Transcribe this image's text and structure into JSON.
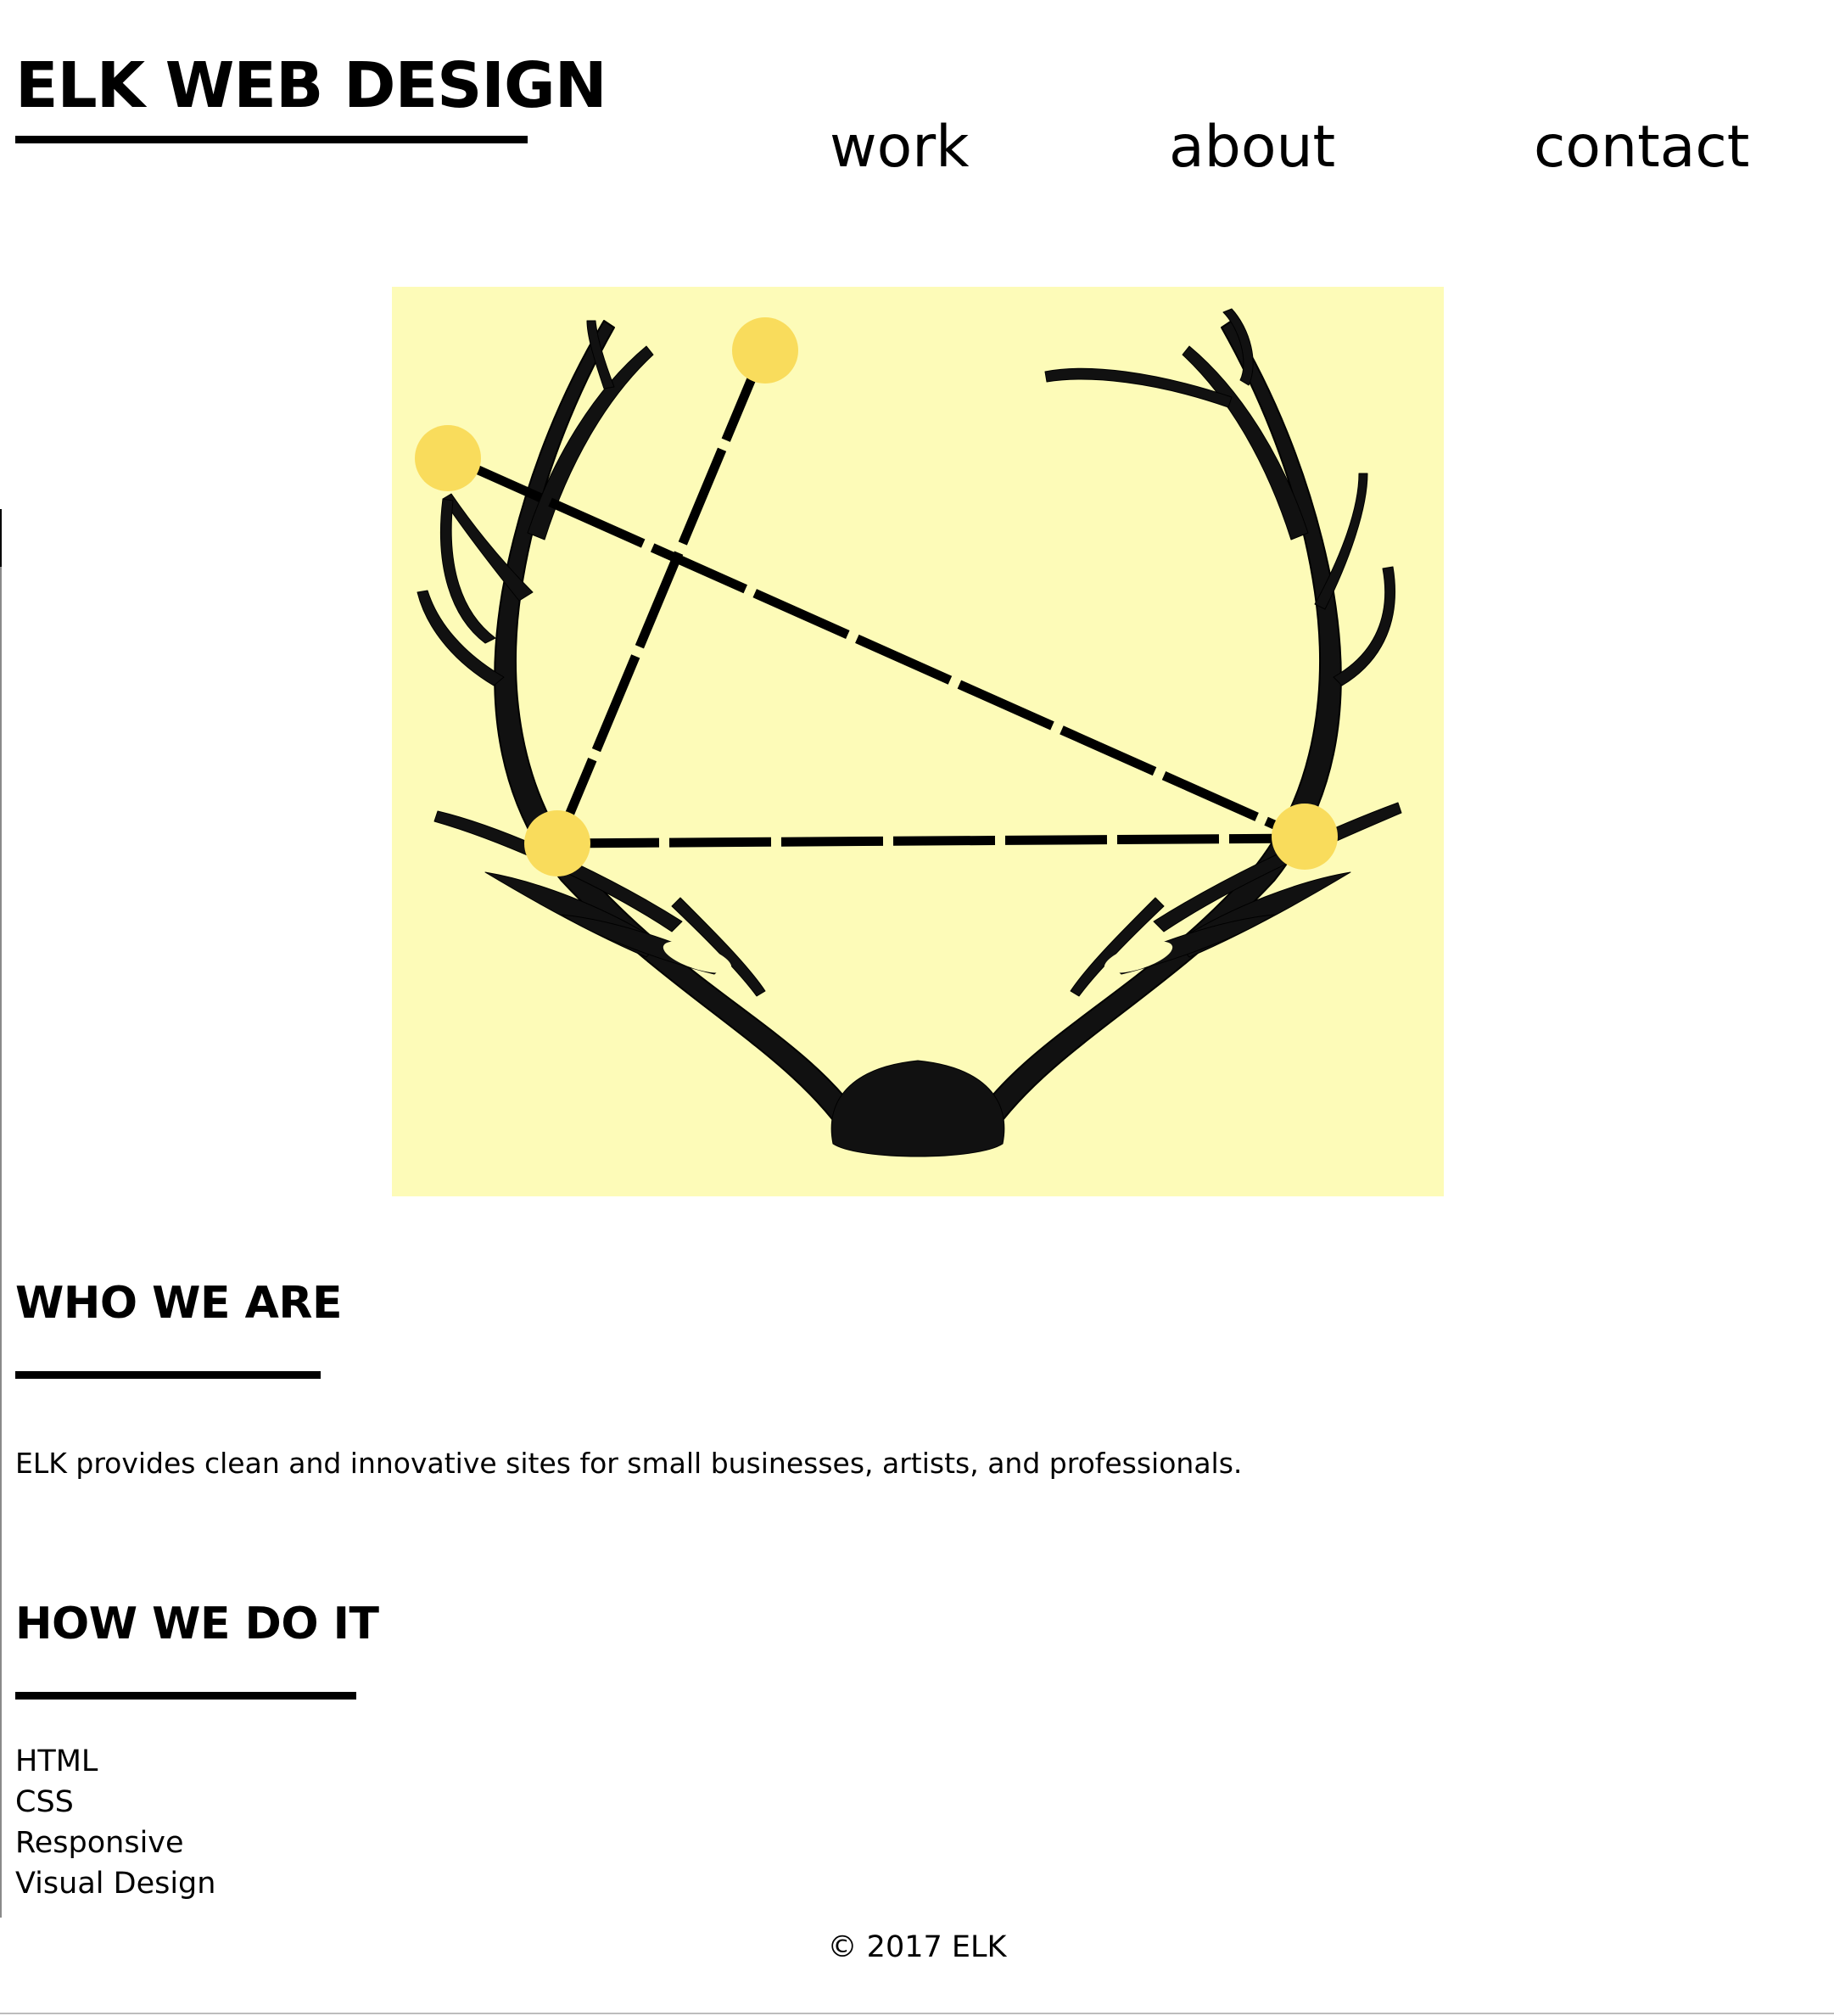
{
  "header": {
    "logo": "ELK WEB DESIGN",
    "nav": [
      {
        "label": "work"
      },
      {
        "label": "about"
      },
      {
        "label": "contact"
      }
    ]
  },
  "hero": {
    "image": "elk-antlers-constellation",
    "background_color": "#fdfbb8",
    "dot_color": "#f9dc5c"
  },
  "who_we_are": {
    "title": "WHO WE ARE",
    "text": "ELK provides clean and innovative sites for small businesses, artists, and professionals."
  },
  "how_we_do_it": {
    "title": "HOW WE DO IT",
    "items": [
      "HTML",
      "CSS",
      "Responsive",
      "Visual Design"
    ]
  },
  "footer": {
    "copyright": "© 2017 ELK"
  }
}
